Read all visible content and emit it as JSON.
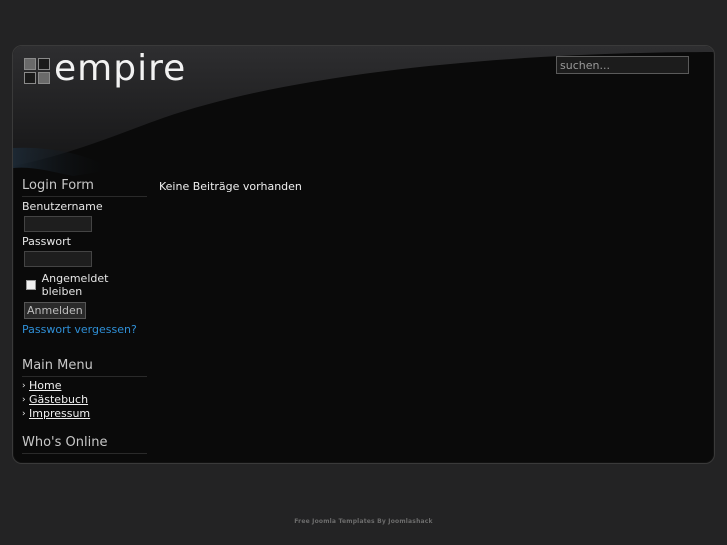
{
  "header": {
    "logo_text": "empire",
    "search_placeholder": "suchen..."
  },
  "login": {
    "title": "Login Form",
    "username_label": "Benutzername",
    "password_label": "Passwort",
    "remember_label": "Angemeldet bleiben",
    "remember_checked": false,
    "submit_label": "Anmelden",
    "forgot_link": "Passwort vergessen?"
  },
  "main_menu": {
    "title": "Main Menu",
    "items": [
      {
        "label": "Home"
      },
      {
        "label": "Gästebuch"
      },
      {
        "label": "Impressum"
      }
    ]
  },
  "whos_online": {
    "title": "Who's Online"
  },
  "content": {
    "message": "Keine Beiträge vorhanden"
  },
  "footer": {
    "text": "Free Joomla Templates By Joomlashack"
  },
  "colors": {
    "page_background": "#232324",
    "frame_background": "#0a0a0a",
    "link_accent": "#2f8fd6"
  }
}
